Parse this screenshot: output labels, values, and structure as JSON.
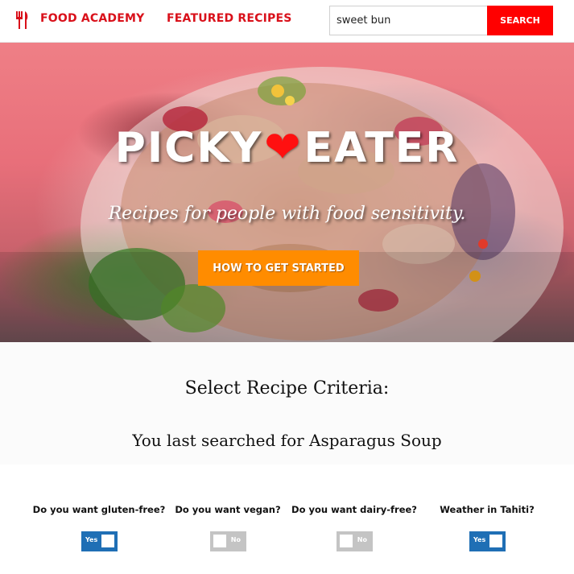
{
  "nav": {
    "academy_label": "Food Academy",
    "featured_label": "Featured Recipes",
    "search_value": "sweet bun",
    "search_button_label": "Search",
    "link_color": "#d9101a",
    "search_button_color": "#ff0000"
  },
  "hero": {
    "title_part1": "PICKY",
    "title_heart": "❤",
    "title_part2": "EATER",
    "subtitle": "Recipes for people with food sensitivity.",
    "cta_label": "How to get started",
    "cta_color": "#ff8c00"
  },
  "criteria": {
    "heading": "Select Recipe Criteria:",
    "last_search_prefix": "You last searched for",
    "last_search_term": "Asparagus Soup",
    "questions": [
      {
        "label": "Do you want gluten-free?",
        "toggle_text": "Yes",
        "state": "on"
      },
      {
        "label": "Do you want vegan?",
        "toggle_text": "No",
        "state": "off"
      },
      {
        "label": "Do you want dairy-free?",
        "toggle_text": "No",
        "state": "off"
      },
      {
        "label": "Weather in Tahiti?",
        "toggle_text": "Yes",
        "state": "on"
      }
    ],
    "toggle_on_color": "#1f6fb5",
    "toggle_off_color": "#c4c4c4"
  }
}
